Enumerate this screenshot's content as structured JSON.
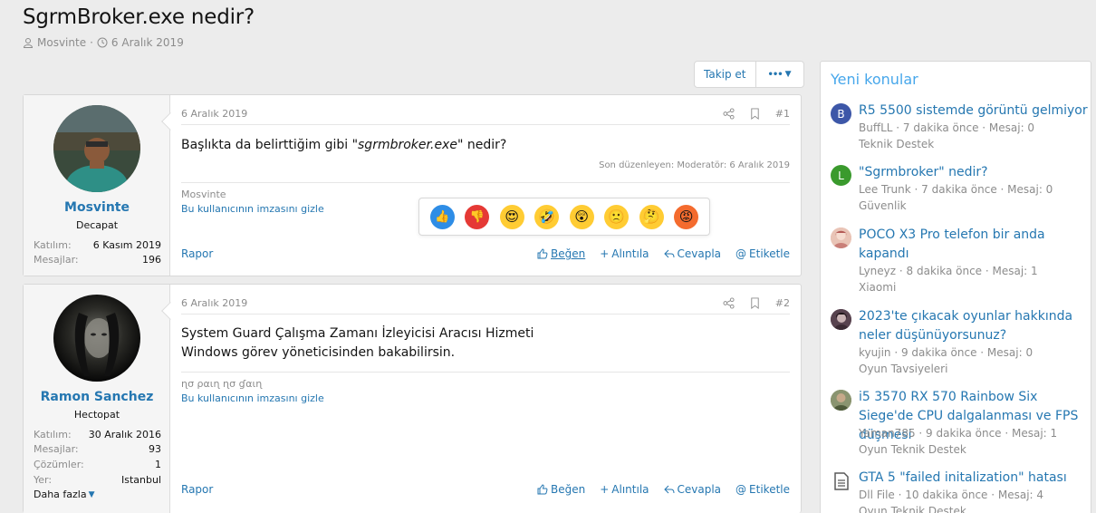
{
  "thread": {
    "title": "SgrmBroker.exe nedir?",
    "author": "Mosvinte",
    "date": "6 Aralık 2019",
    "follow_label": "Takip et",
    "more_label": "•••"
  },
  "posts": [
    {
      "date": "6 Aralık 2019",
      "number": "#1",
      "username": "Mosvinte",
      "user_title": "Decapat",
      "stats": [
        {
          "key": "Katılım:",
          "value": "6 Kasım 2019"
        },
        {
          "key": "Mesajlar:",
          "value": "196"
        }
      ],
      "message_pre": "Başlıkta da belirttiğim gibi \"",
      "message_em": "sgrmbroker.exe",
      "message_post": "\" nedir?",
      "edited": "Son düzenleyen: Moderatör: 6 Aralık 2019",
      "signature_name": "Mosvinte",
      "hide_signature": "Bu kullanıcının imzasını gizle",
      "actions": {
        "report": "Rapor",
        "like": "Beğen",
        "quote": "Alıntıla",
        "reply": "Cevapla",
        "tag": "Etiketle"
      }
    },
    {
      "date": "6 Aralık 2019",
      "number": "#2",
      "username": "Ramon Sanchez",
      "user_title": "Hectopat",
      "stats": [
        {
          "key": "Katılım:",
          "value": "30 Aralık 2016"
        },
        {
          "key": "Mesajlar:",
          "value": "93"
        },
        {
          "key": "Çözümler:",
          "value": "1"
        },
        {
          "key": "Yer:",
          "value": "Istanbul"
        }
      ],
      "more_label": "Daha fazla",
      "message_line1": "System Guard Çalışma Zamanı İzleyicisi Aracısı Hizmeti",
      "message_line2": "Windows görev yöneticisinden bakabilirsin.",
      "signature_name": "ɳσ ραιɳ ɳσ ɠαιɳ",
      "hide_signature": "Bu kullanıcının imzasını gizle",
      "actions": {
        "report": "Rapor",
        "like": "Beğen",
        "quote": "Alıntıla",
        "reply": "Cevapla",
        "tag": "Etiketle"
      }
    }
  ],
  "reactions": [
    "thumbs-up",
    "thumbs-down",
    "heart-eyes",
    "rofl",
    "astonished",
    "frowning",
    "thinking",
    "angry"
  ],
  "sidebar": {
    "title": "Yeni konular",
    "threads": [
      {
        "avatar_letter": "B",
        "avatar_color": "#3d57a8",
        "title": "R5 5500 sistemde görüntü gelmiyor",
        "meta": "BuffLL · 7 dakika önce · Mesaj: 0",
        "forum": "Teknik Destek"
      },
      {
        "avatar_letter": "L",
        "avatar_color": "#3a9a2d",
        "title": "\"Sgrmbroker\" nedir?",
        "meta": "Lee Trunk · 7 dakika önce · Mesaj: 0",
        "forum": "Güvenlik"
      },
      {
        "avatar_letter": "",
        "avatar_color": "#e8b7a6",
        "title": "POCO X3 Pro telefon bir anda kapandı",
        "meta": "Lyneyz · 8 dakika önce · Mesaj: 1",
        "forum": "Xiaomi"
      },
      {
        "avatar_letter": "",
        "avatar_color": "#6b5263",
        "title": "2023'te çıkacak oyunlar hakkında neler düşünüyorsunuz?",
        "meta": "kyujin · 9 dakika önce · Mesaj: 0",
        "forum": "Oyun Tavsiyeleri"
      },
      {
        "avatar_letter": "",
        "avatar_color": "#7d8a5a",
        "title": "i5 3570 RX 570 Rainbow Six Siege'de CPU dalgalanması ve FPS düşmesi",
        "meta": "Yaman785 · 9 dakika önce · Mesaj: 1",
        "forum": "Oyun Teknik Destek"
      },
      {
        "avatar_letter": "",
        "avatar_color": "#ffffff",
        "title": "GTA 5 \"failed initalization\" hatası",
        "meta": "Dll File · 10 dakika önce · Mesaj: 4",
        "forum": "Oyun Teknik Destek"
      }
    ]
  }
}
